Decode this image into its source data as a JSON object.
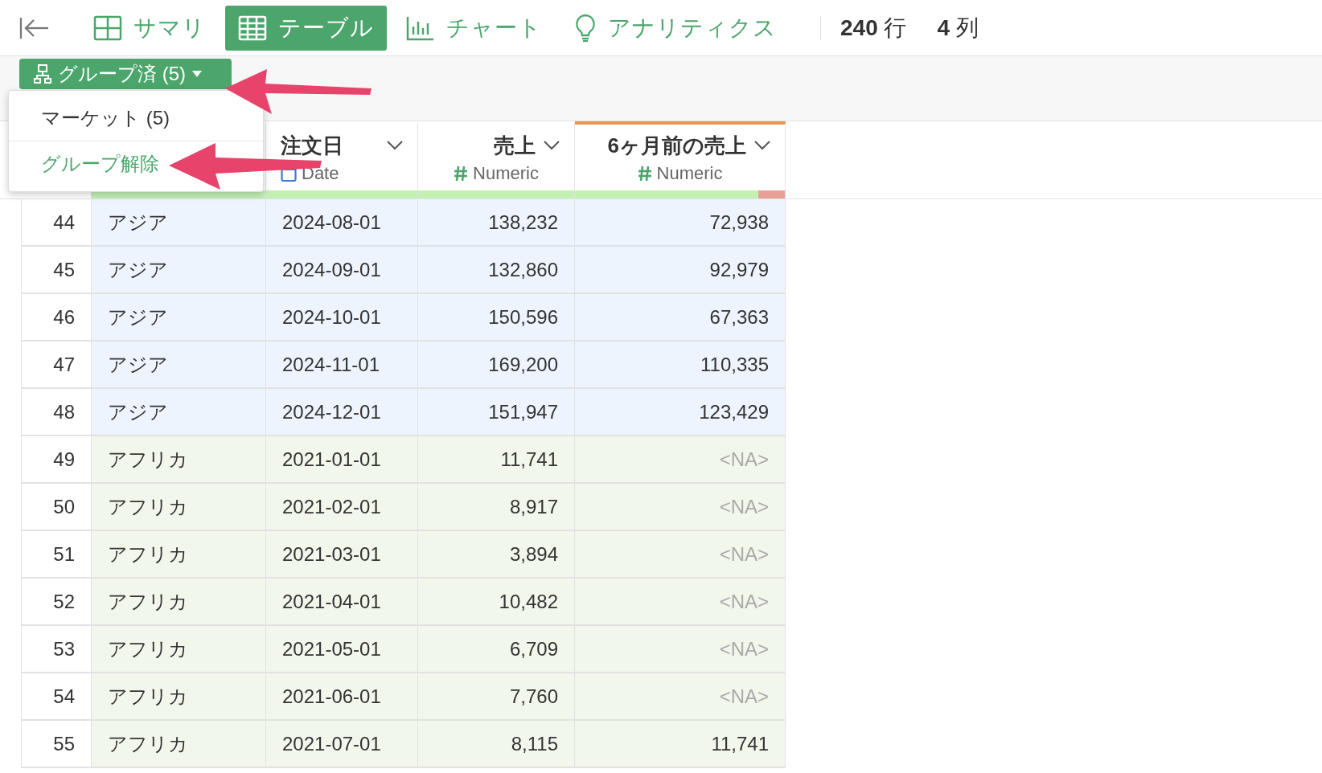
{
  "toolbar": {
    "tabs": [
      {
        "label": "サマリ",
        "kind": "summary",
        "selected": false
      },
      {
        "label": "テーブル",
        "kind": "table",
        "selected": true
      },
      {
        "label": "チャート",
        "kind": "chart",
        "selected": false
      },
      {
        "label": "アナリティクス",
        "kind": "analytics",
        "selected": false
      }
    ],
    "row_count": "**240** 行",
    "column_count": "**4** 列"
  },
  "grouping": {
    "button_label": "グループ済 (5)",
    "menu": [
      {
        "label": "マーケット (5)",
        "kind": "option"
      },
      {
        "label": "グループ解除",
        "kind": "action"
      }
    ]
  },
  "table": {
    "columns": [
      {
        "kind": "text",
        "quality": {
          "level": 1
        }
      },
      {
        "name": "注文日",
        "type": "Date",
        "kind": "date",
        "quality": {
          "level": 1
        }
      },
      {
        "name": "売上",
        "type": "Numeric",
        "kind": "numeric",
        "quality": {
          "level": 1
        }
      },
      {
        "name": "6ヶ月前の売上",
        "type": "Numeric",
        "kind": "numeric",
        "color": "#e8944a",
        "quality": {
          "level": 0.875
        }
      }
    ],
    "rows": [
      {
        "n": "44",
        "color": "#eef4fd",
        "cells": [
          {
            "text": "アジア",
            "missing": false
          },
          {
            "text": "2024-08-01",
            "missing": false
          },
          {
            "text": "138,232",
            "missing": false
          },
          {
            "text": "72,938",
            "missing": false
          }
        ]
      },
      {
        "n": "45",
        "color": "#eef4fd",
        "cells": [
          {
            "text": "アジア",
            "missing": false
          },
          {
            "text": "2024-09-01",
            "missing": false
          },
          {
            "text": "132,860",
            "missing": false
          },
          {
            "text": "92,979",
            "missing": false
          }
        ]
      },
      {
        "n": "46",
        "color": "#eef4fd",
        "cells": [
          {
            "text": "アジア",
            "missing": false
          },
          {
            "text": "2024-10-01",
            "missing": false
          },
          {
            "text": "150,596",
            "missing": false
          },
          {
            "text": "67,363",
            "missing": false
          }
        ]
      },
      {
        "n": "47",
        "color": "#eef4fd",
        "cells": [
          {
            "text": "アジア",
            "missing": false
          },
          {
            "text": "2024-11-01",
            "missing": false
          },
          {
            "text": "169,200",
            "missing": false
          },
          {
            "text": "110,335",
            "missing": false
          }
        ]
      },
      {
        "n": "48",
        "color": "#eef4fd",
        "cells": [
          {
            "text": "アジア",
            "missing": false
          },
          {
            "text": "2024-12-01",
            "missing": false
          },
          {
            "text": "151,947",
            "missing": false
          },
          {
            "text": "123,429",
            "missing": false
          }
        ]
      },
      {
        "n": "49",
        "color": "#f2f7ec",
        "cells": [
          {
            "text": "アフリカ",
            "missing": false
          },
          {
            "text": "2021-01-01",
            "missing": false
          },
          {
            "text": "11,741",
            "missing": false
          },
          {
            "text": "<NA>",
            "missing": true
          }
        ]
      },
      {
        "n": "50",
        "color": "#f2f7ec",
        "cells": [
          {
            "text": "アフリカ",
            "missing": false
          },
          {
            "text": "2021-02-01",
            "missing": false
          },
          {
            "text": "8,917",
            "missing": false
          },
          {
            "text": "<NA>",
            "missing": true
          }
        ]
      },
      {
        "n": "51",
        "color": "#f2f7ec",
        "cells": [
          {
            "text": "アフリカ",
            "missing": false
          },
          {
            "text": "2021-03-01",
            "missing": false
          },
          {
            "text": "3,894",
            "missing": false
          },
          {
            "text": "<NA>",
            "missing": true
          }
        ]
      },
      {
        "n": "52",
        "color": "#f2f7ec",
        "cells": [
          {
            "text": "アフリカ",
            "missing": false
          },
          {
            "text": "2021-04-01",
            "missing": false
          },
          {
            "text": "10,482",
            "missing": false
          },
          {
            "text": "<NA>",
            "missing": true
          }
        ]
      },
      {
        "n": "53",
        "color": "#f2f7ec",
        "cells": [
          {
            "text": "アフリカ",
            "missing": false
          },
          {
            "text": "2021-05-01",
            "missing": false
          },
          {
            "text": "6,709",
            "missing": false
          },
          {
            "text": "<NA>",
            "missing": true
          }
        ]
      },
      {
        "n": "54",
        "color": "#f2f7ec",
        "cells": [
          {
            "text": "アフリカ",
            "missing": false
          },
          {
            "text": "2021-06-01",
            "missing": false
          },
          {
            "text": "7,760",
            "missing": false
          },
          {
            "text": "<NA>",
            "missing": true
          }
        ]
      },
      {
        "n": "55",
        "color": "#f2f7ec",
        "cells": [
          {
            "text": "アフリカ",
            "missing": false
          },
          {
            "text": "2021-07-01",
            "missing": false
          },
          {
            "text": "8,115",
            "missing": false
          },
          {
            "text": "11,741",
            "missing": false
          }
        ]
      }
    ]
  }
}
